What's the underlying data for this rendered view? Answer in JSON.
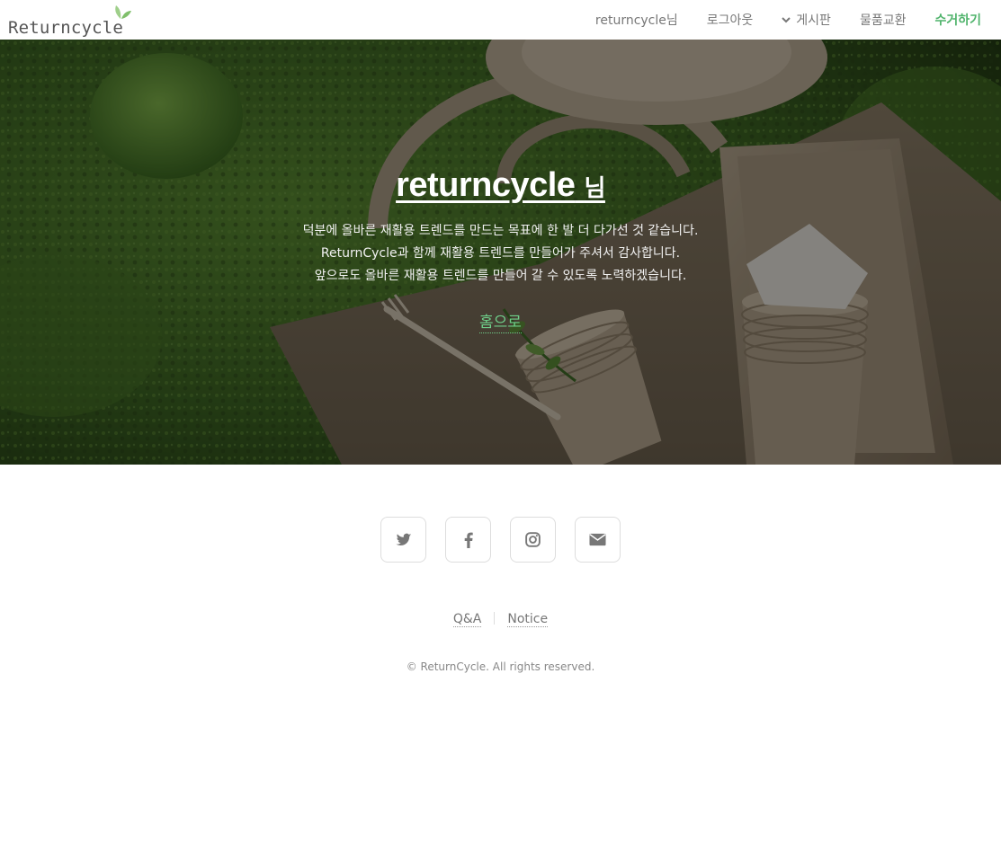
{
  "header": {
    "logo_text": "Returncycle",
    "nav": {
      "user": "returncycle님",
      "logout": "로그아웃",
      "board": "게시판",
      "exchange": "물품교환",
      "collect": "수거하기"
    }
  },
  "hero": {
    "title": "returncycle",
    "title_suffix": "님",
    "lines": [
      "덕분에 올바른 재활용 트렌드를 만드는 목표에 한 발 더 다가선 것 같습니다.",
      "ReturnCycle과 함께 재활용 트렌드를 만들어가 주셔서 감사합니다.",
      "앞으로도 올바른 재활용 트렌드를 만들어 갈 수 있도록 노력하겠습니다."
    ],
    "home_link": "홈으로"
  },
  "footer": {
    "socials": [
      "twitter-icon",
      "facebook-icon",
      "instagram-icon",
      "envelope-icon"
    ],
    "links": [
      "Q&A",
      "Notice"
    ],
    "copyright": "© ReturnCycle. All rights reserved."
  },
  "colors": {
    "accent": "#4fb36b",
    "home_link": "#6fcf8a",
    "moss_dark": "#2c4a1c",
    "moss": "#4a7a2a",
    "kraft": "#8f7f6a"
  }
}
